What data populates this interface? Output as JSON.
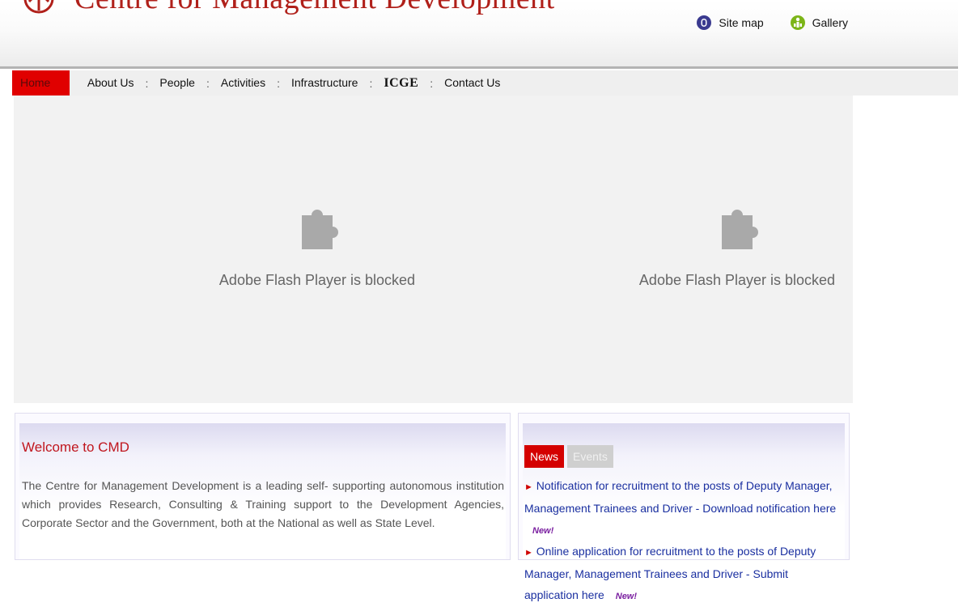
{
  "header": {
    "site_title": "Centre for Management Development",
    "toplinks": [
      {
        "label": "Site map",
        "icon": "sitemap-icon",
        "color": "#3a3a8f"
      },
      {
        "label": "Gallery",
        "icon": "gallery-icon",
        "color": "#7cb518"
      }
    ]
  },
  "nav": {
    "items": [
      {
        "label": "Home",
        "active": true
      },
      {
        "label": "About Us"
      },
      {
        "label": "People"
      },
      {
        "label": "Activities"
      },
      {
        "label": "Infrastructure"
      },
      {
        "label": "ICGE"
      },
      {
        "label": "Contact Us"
      }
    ],
    "separator": ":",
    "active_color": "#e00000"
  },
  "flash": {
    "messages": [
      "Adobe Flash Player is blocked",
      "Adobe Flash Player is blocked"
    ],
    "icon": "plugin-puzzle-icon"
  },
  "welcome": {
    "title": "Welcome to CMD",
    "text": "The Centre for Management Development is a leading self- supporting autonomous institution which provides Research, Consulting & Training support to the Development Agencies, Corporate Sector and the Government, both at the National as well as State Level."
  },
  "news": {
    "tabs": [
      {
        "label": "News",
        "active": true
      },
      {
        "label": "Events"
      }
    ],
    "items": [
      {
        "text": "Notification for recruitment to the posts of Deputy Manager, Management Trainees and Driver - Download notification here",
        "badge": "New!"
      },
      {
        "text": "Online application for recruitment to the posts of Deputy Manager, Management Trainees and Driver - Submit application here",
        "badge": "New!"
      }
    ]
  }
}
